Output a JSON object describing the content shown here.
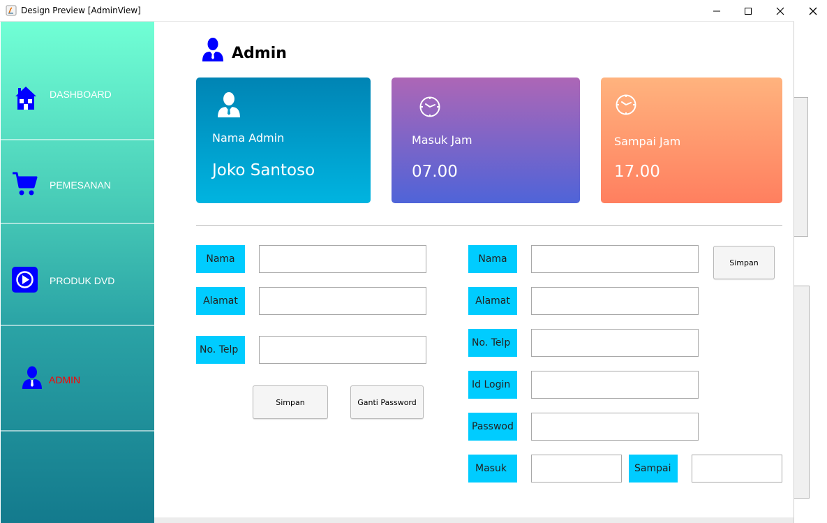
{
  "window": {
    "title": "Design Preview [AdminView]"
  },
  "sidebar": {
    "items": [
      {
        "label": "DASHBOARD",
        "icon": "house-icon",
        "color": "#ffffff"
      },
      {
        "label": "PEMESANAN",
        "icon": "cart-icon",
        "color": "#ffffff"
      },
      {
        "label": "PRODUK DVD",
        "icon": "play-icon",
        "color": "#ffffff"
      },
      {
        "label": "ADMIN",
        "icon": "user-icon",
        "color": "#ff0000"
      }
    ]
  },
  "header": {
    "title": "Admin",
    "icon": "user-icon"
  },
  "cards": [
    {
      "label": "Nama Admin",
      "value": "Joko Santoso",
      "icon": "user-icon"
    },
    {
      "label": "Masuk Jam",
      "value": "07.00",
      "icon": "clock-icon"
    },
    {
      "label": "Sampai Jam",
      "value": "17.00",
      "icon": "clock-icon"
    }
  ],
  "left_form": {
    "nama_label": "Nama",
    "alamat_label": "Alamat",
    "telp_label": "No. Telp",
    "nama_value": "",
    "alamat_value": "",
    "telp_value": "",
    "save_button": "Simpan",
    "change_password_button": "Ganti Password"
  },
  "right_form": {
    "nama_label": "Nama",
    "alamat_label": "Alamat",
    "telp_label": "No. Telp",
    "login_label": "Id Login",
    "password_label": "Passwod",
    "masuk_label": "Masuk",
    "sampai_label": "Sampai",
    "save_button": "Simpan"
  },
  "colors": {
    "accent_label": "#00ccff",
    "sidebar_top": "#71ffd5",
    "sidebar_bottom": "#137a8d",
    "card1": "#0088b8",
    "card2": "#a366b8",
    "card3": "#ffa77d",
    "icon_blue": "#0000ff"
  }
}
